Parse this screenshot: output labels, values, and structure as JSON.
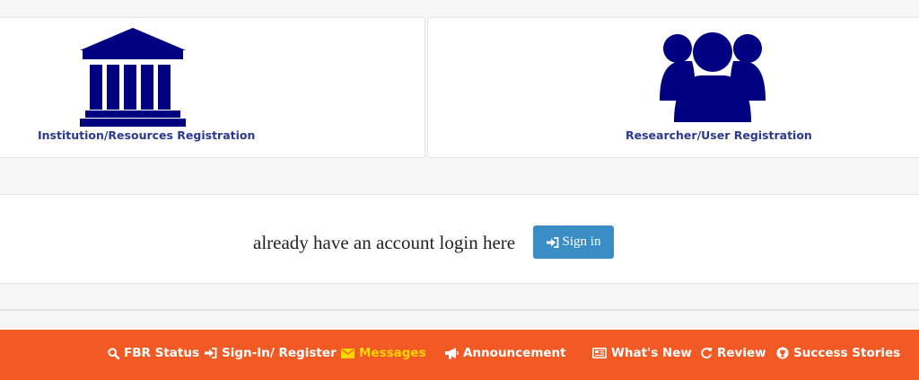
{
  "registration": {
    "institution": {
      "label": "Institution/Resources Registration",
      "icon": "institution-building-icon"
    },
    "researcher": {
      "label": "Researcher/User Registration",
      "icon": "users-group-icon"
    }
  },
  "login": {
    "prompt": "already have an account login here",
    "signin_label": "Sign in",
    "signin_icon": "sign-in-icon"
  },
  "footer_nav": [
    {
      "label": "FBR Status",
      "icon": "search-icon"
    },
    {
      "label": "Sign-In/ Register",
      "icon": "sign-in-icon"
    },
    {
      "label": "Messages",
      "icon": "envelope-icon",
      "active": true
    },
    {
      "label": "Announcement",
      "icon": "bullhorn-icon"
    },
    {
      "label": "What's New",
      "icon": "newspaper-icon"
    },
    {
      "label": "Review",
      "icon": "refresh-icon"
    },
    {
      "label": "Success Stories",
      "icon": "trophy-icon"
    }
  ],
  "colors": {
    "brand_navy": "#000080",
    "label_blue": "#2b3990",
    "button_blue": "#3a8ec5",
    "footer_orange": "#f15a24",
    "active_yellow": "#ffd400"
  }
}
